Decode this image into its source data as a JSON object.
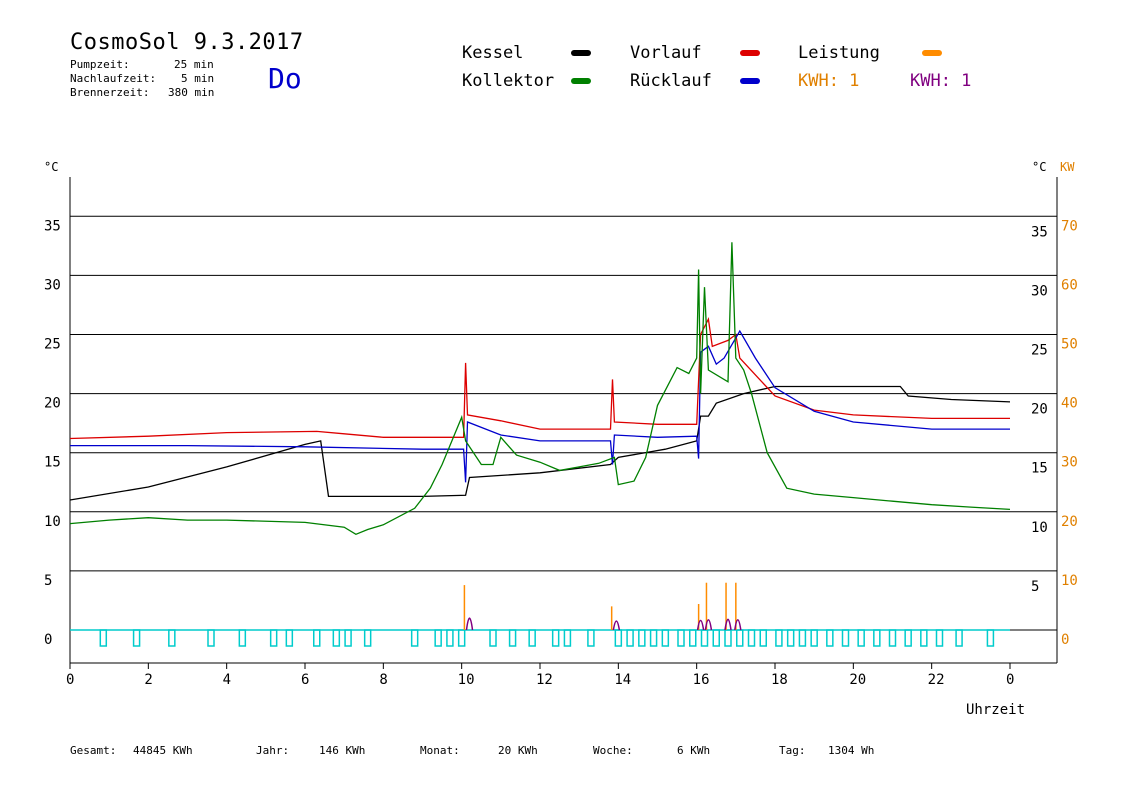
{
  "header": {
    "title": "CosmoSol 9.3.2017",
    "pumpzeit_label": "Pumpzeit:",
    "pumpzeit_value": "25 min",
    "nachlauf_label": "Nachlaufzeit:",
    "nachlauf_value": "5 min",
    "brenner_label": "Brennerzeit:",
    "brenner_value": "380 min",
    "day": "Do"
  },
  "legend": {
    "kessel": "Kessel",
    "kollektor": "Kollektor",
    "vorlauf": "Vorlauf",
    "ruecklauf": "Rücklauf",
    "leistung": "Leistung",
    "kwh1": "KWH: 1",
    "kwh2": "KWH: 1"
  },
  "colors": {
    "kessel": "#000000",
    "kollektor": "#008000",
    "vorlauf": "#dd0000",
    "ruecklauf": "#0000cc",
    "leistung": "#ff8c00",
    "kwh2": "#800080",
    "pump": "#00cccc",
    "axis_right": "#e08000"
  },
  "footer": {
    "gesamt_label": "Gesamt:",
    "gesamt_value": "44845 KWh",
    "jahr_label": "Jahr:",
    "jahr_value": "146 KWh",
    "monat_label": "Monat:",
    "monat_value": "20 KWh",
    "woche_label": "Woche:",
    "woche_value": "6 KWh",
    "tag_label": "Tag:",
    "tag_value": "1304 Wh"
  },
  "chart_data": {
    "type": "line",
    "xlabel": "Uhrzeit",
    "ylabel_left": "°C",
    "ylabel_right_unit": "°C",
    "ylabel_right_power": "KW",
    "x_ticks": [
      "0",
      "2",
      "4",
      "6",
      "8",
      "10",
      "12",
      "14",
      "16",
      "18",
      "20",
      "22",
      "0"
    ],
    "y_ticks_left": [
      "0",
      "5",
      "10",
      "15",
      "20",
      "25",
      "30",
      "35"
    ],
    "y_ticks_right_temp": [
      "5",
      "10",
      "15",
      "20",
      "25",
      "30",
      "35"
    ],
    "y_ticks_right_power": [
      "0",
      "10",
      "20",
      "30",
      "40",
      "50",
      "60",
      "70"
    ],
    "xlim": [
      0,
      24
    ],
    "ylim": [
      0,
      40
    ],
    "grid": true,
    "series": [
      {
        "name": "Kessel",
        "key": "kessel",
        "points": [
          [
            0,
            11
          ],
          [
            2,
            12.1
          ],
          [
            4,
            13.8
          ],
          [
            6,
            15.7
          ],
          [
            6.4,
            16
          ],
          [
            6.6,
            11.3
          ],
          [
            9,
            11.3
          ],
          [
            10.1,
            11.4
          ],
          [
            10.2,
            12.9
          ],
          [
            12,
            13.3
          ],
          [
            13.8,
            14
          ],
          [
            14,
            14.6
          ],
          [
            15.2,
            15.3
          ],
          [
            16,
            16
          ],
          [
            16.1,
            18.1
          ],
          [
            16.3,
            18.1
          ],
          [
            16.5,
            19.2
          ],
          [
            17.2,
            20
          ],
          [
            18,
            20.6
          ],
          [
            20,
            20.6
          ],
          [
            21.2,
            20.6
          ],
          [
            21.4,
            19.8
          ],
          [
            22.5,
            19.5
          ],
          [
            24,
            19.3
          ]
        ]
      },
      {
        "name": "Vorlauf",
        "key": "vorlauf",
        "points": [
          [
            0,
            16.2
          ],
          [
            2,
            16.4
          ],
          [
            4,
            16.7
          ],
          [
            6.3,
            16.8
          ],
          [
            7,
            16.6
          ],
          [
            8,
            16.3
          ],
          [
            10.05,
            16.3
          ],
          [
            10.1,
            22.6
          ],
          [
            10.15,
            18.2
          ],
          [
            11,
            17.7
          ],
          [
            12,
            17
          ],
          [
            13.8,
            17
          ],
          [
            13.85,
            21.2
          ],
          [
            13.9,
            17.6
          ],
          [
            15,
            17.4
          ],
          [
            16,
            17.4
          ],
          [
            16.1,
            25
          ],
          [
            16.3,
            26.3
          ],
          [
            16.4,
            24
          ],
          [
            16.8,
            24.5
          ],
          [
            17,
            25
          ],
          [
            17.1,
            23
          ],
          [
            18,
            19.8
          ],
          [
            19,
            18.6
          ],
          [
            20,
            18.2
          ],
          [
            22,
            17.9
          ],
          [
            24,
            17.9
          ]
        ]
      },
      {
        "name": "Rücklauf",
        "key": "ruecklauf",
        "points": [
          [
            0,
            15.6
          ],
          [
            3,
            15.6
          ],
          [
            6,
            15.5
          ],
          [
            9,
            15.3
          ],
          [
            10.05,
            15.3
          ],
          [
            10.1,
            12.5
          ],
          [
            10.15,
            17.6
          ],
          [
            11,
            16.5
          ],
          [
            12,
            16
          ],
          [
            13.8,
            16
          ],
          [
            13.85,
            14
          ],
          [
            13.9,
            16.5
          ],
          [
            15,
            16.3
          ],
          [
            16,
            16.4
          ],
          [
            16.05,
            14.5
          ],
          [
            16.1,
            23.5
          ],
          [
            16.3,
            24
          ],
          [
            16.5,
            22.5
          ],
          [
            16.7,
            23
          ],
          [
            17.1,
            25.3
          ],
          [
            17.5,
            23
          ],
          [
            18,
            20.5
          ],
          [
            19,
            18.5
          ],
          [
            20,
            17.6
          ],
          [
            22,
            17
          ],
          [
            24,
            17
          ]
        ]
      },
      {
        "name": "Kollektor",
        "key": "kollektor",
        "points": [
          [
            0,
            9
          ],
          [
            1,
            9.3
          ],
          [
            2,
            9.5
          ],
          [
            3,
            9.3
          ],
          [
            4,
            9.3
          ],
          [
            6,
            9.1
          ],
          [
            7,
            8.7
          ],
          [
            7.3,
            8.1
          ],
          [
            7.6,
            8.5
          ],
          [
            8,
            8.9
          ],
          [
            8.8,
            10.3
          ],
          [
            9.2,
            12
          ],
          [
            9.5,
            14
          ],
          [
            10,
            18
          ],
          [
            10.1,
            16
          ],
          [
            10.5,
            14
          ],
          [
            10.8,
            14
          ],
          [
            11,
            16.3
          ],
          [
            11.4,
            14.8
          ],
          [
            12,
            14.2
          ],
          [
            12.5,
            13.5
          ],
          [
            13,
            13.8
          ],
          [
            13.5,
            14.1
          ],
          [
            13.9,
            14.6
          ],
          [
            14,
            12.3
          ],
          [
            14.4,
            12.6
          ],
          [
            14.7,
            14.6
          ],
          [
            15,
            19
          ],
          [
            15.5,
            22.2
          ],
          [
            15.8,
            21.7
          ],
          [
            16,
            23
          ],
          [
            16.05,
            30.5
          ],
          [
            16.1,
            20
          ],
          [
            16.2,
            29
          ],
          [
            16.3,
            22
          ],
          [
            16.8,
            21
          ],
          [
            16.9,
            32.8
          ],
          [
            17,
            23
          ],
          [
            17.2,
            22
          ],
          [
            17.4,
            20
          ],
          [
            17.8,
            15
          ],
          [
            18.3,
            12
          ],
          [
            19,
            11.5
          ],
          [
            20,
            11.2
          ],
          [
            21,
            10.9
          ],
          [
            22,
            10.6
          ],
          [
            23,
            10.4
          ],
          [
            24,
            10.2
          ]
        ]
      }
    ],
    "power_series": {
      "name": "Leistung",
      "key": "leistung",
      "spikes": [
        [
          10.07,
          3.8
        ],
        [
          13.83,
          2
        ],
        [
          16.05,
          2.2
        ],
        [
          16.25,
          4
        ],
        [
          16.75,
          4
        ],
        [
          17.0,
          4
        ]
      ]
    },
    "kwh_series": {
      "name": "KWH",
      "key": "kwh2",
      "bumps": [
        [
          10.2,
          1.5
        ],
        [
          13.95,
          1
        ],
        [
          16.1,
          1.1
        ],
        [
          16.3,
          1.2
        ],
        [
          16.8,
          1.3
        ],
        [
          17.05,
          1.2
        ]
      ]
    },
    "pump_pulses": [
      0.85,
      1.7,
      2.6,
      3.6,
      4.4,
      5.2,
      5.6,
      6.3,
      6.8,
      7.1,
      7.6,
      8.8,
      9.4,
      9.7,
      10.0,
      10.8,
      11.3,
      11.8,
      12.4,
      12.7,
      13.3,
      14.0,
      14.3,
      14.6,
      14.9,
      15.2,
      15.6,
      15.9,
      16.2,
      16.5,
      16.8,
      17.1,
      17.4,
      17.7,
      18.1,
      18.4,
      18.7,
      19.0,
      19.4,
      19.8,
      20.2,
      20.6,
      21.0,
      21.4,
      21.8,
      22.2,
      22.7,
      23.5
    ]
  }
}
